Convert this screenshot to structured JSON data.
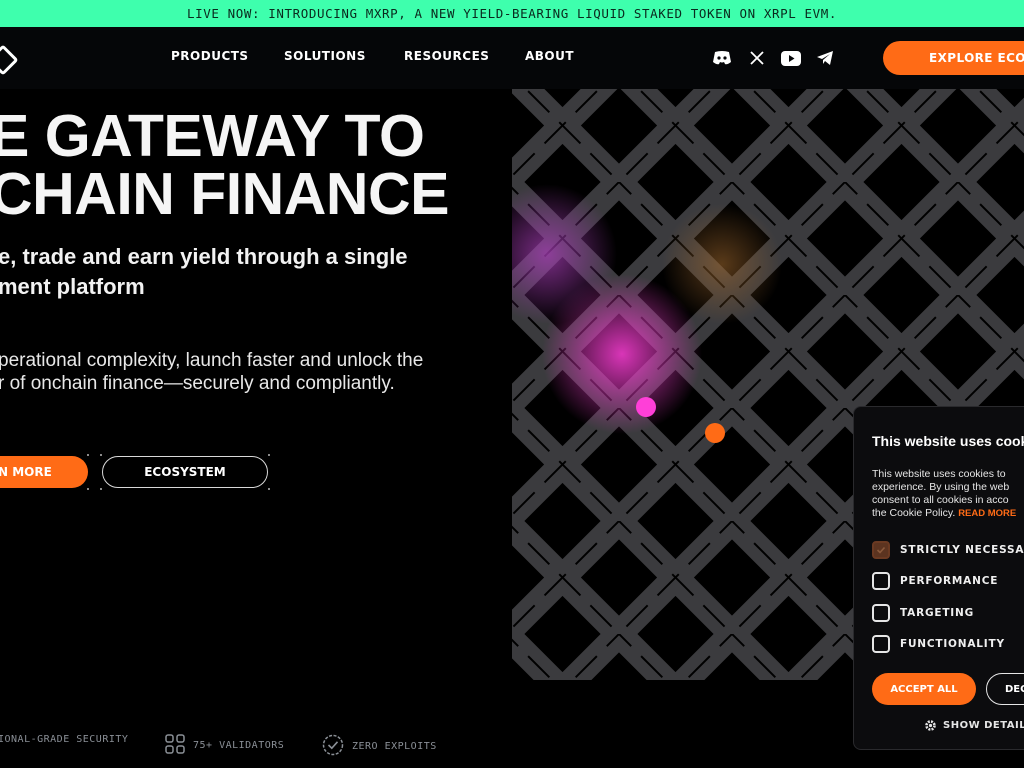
{
  "banner": {
    "text": "LIVE NOW: INTRODUCING MXRP, A NEW YIELD-BEARING LIQUID STAKED TOKEN ON XRPL EVM."
  },
  "nav": {
    "items": [
      {
        "label": "PRODUCTS"
      },
      {
        "label": "SOLUTIONS"
      },
      {
        "label": "RESOURCES"
      },
      {
        "label": "ABOUT"
      }
    ],
    "social_icons": [
      "discord-icon",
      "x-icon",
      "youtube-icon",
      "telegram-icon"
    ],
    "cta_label": "EXPLORE ECOSY"
  },
  "hero": {
    "title_line1": "E GATEWAY TO",
    "title_line2": "CHAIN FINANCE",
    "subtitle_line1": "e, trade and earn yield through a single",
    "subtitle_line2": "ment platform",
    "desc_line1": "perational complexity, launch faster and unlock the",
    "desc_line2": "r of onchain finance—securely and compliantly.",
    "primary_button": "N MORE",
    "secondary_button": "ECOSYSTEM"
  },
  "features": [
    {
      "icon": "shield-icon",
      "label": "IONAL-GRADE SECURITY"
    },
    {
      "icon": "validators-icon",
      "label": "75+ VALIDATORS"
    },
    {
      "icon": "check-badge-icon",
      "label": "ZERO EXPLOITS"
    }
  ],
  "cookie": {
    "title": "This website uses cook",
    "text_line1": "This website uses cookies to",
    "text_line2": "experience. By using the web",
    "text_line3": "consent to all cookies in acco",
    "text_line4": "the Cookie Policy.",
    "read_more": "READ MORE",
    "options": [
      {
        "label": "STRICTLY NECESSAR",
        "checked": true
      },
      {
        "label": "PERFORMANCE",
        "checked": false
      },
      {
        "label": "TARGETING",
        "checked": false
      },
      {
        "label": "FUNCTIONALITY",
        "checked": false
      }
    ],
    "accept_label": "ACCEPT ALL",
    "decline_label": "DEC",
    "details_label": "SHOW DETAILS"
  },
  "colors": {
    "banner_bg": "#3effad",
    "accent": "#ff6b16",
    "glow_magenta": "#ff3fd8",
    "page_bg": "#000000"
  }
}
